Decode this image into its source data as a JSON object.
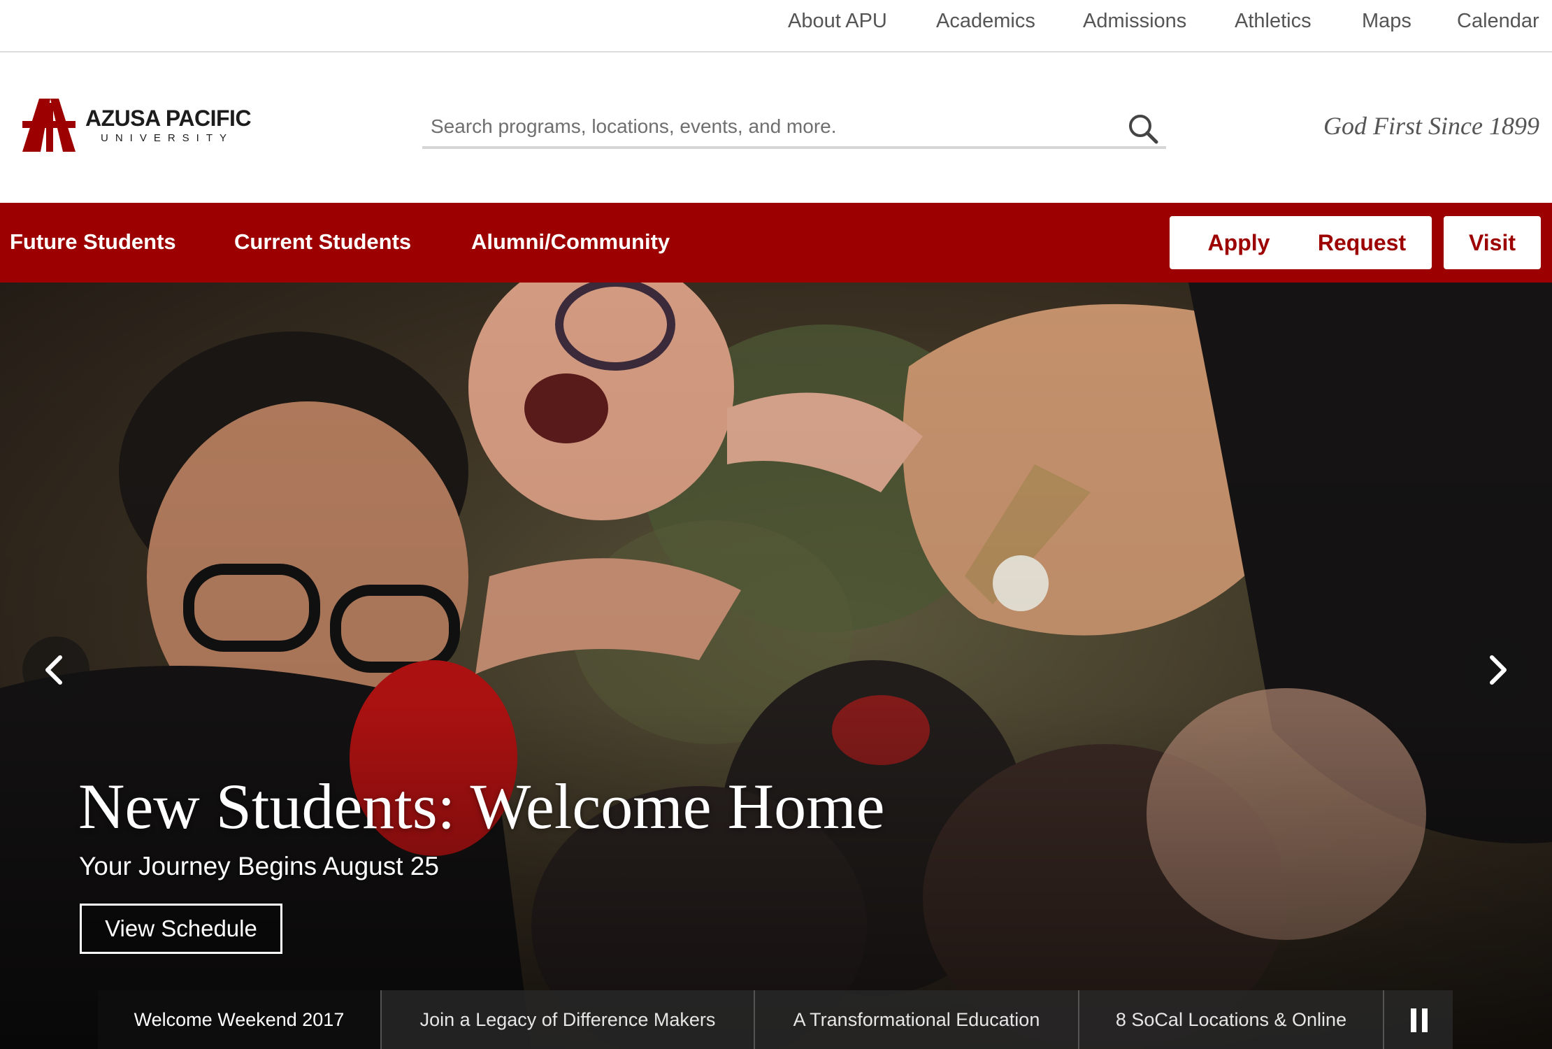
{
  "utility_nav": [
    "About APU",
    "Academics",
    "Admissions",
    "Athletics",
    "Maps",
    "Calendar"
  ],
  "logo": {
    "name": "AZUSA PACIFIC",
    "sub": "UNIVERSITY"
  },
  "search": {
    "placeholder": "Search programs, locations, events, and more."
  },
  "tagline": "God First Since 1899",
  "main_nav": [
    "Future Students",
    "Current Students",
    "Alumni/Community"
  ],
  "cta": {
    "apply": "Apply",
    "request": "Request",
    "visit": "Visit"
  },
  "hero": {
    "title": "New Students: Welcome Home",
    "subtitle": "Your Journey Begins August 25",
    "button": "View Schedule"
  },
  "carousel_tabs": [
    "Welcome Weekend 2017",
    "Join a Legacy of Difference Makers",
    "A Transformational Education",
    "8 SoCal Locations & Online"
  ],
  "colors": {
    "brand_red": "#9d0000",
    "tab_active": "#0d0d0d"
  }
}
